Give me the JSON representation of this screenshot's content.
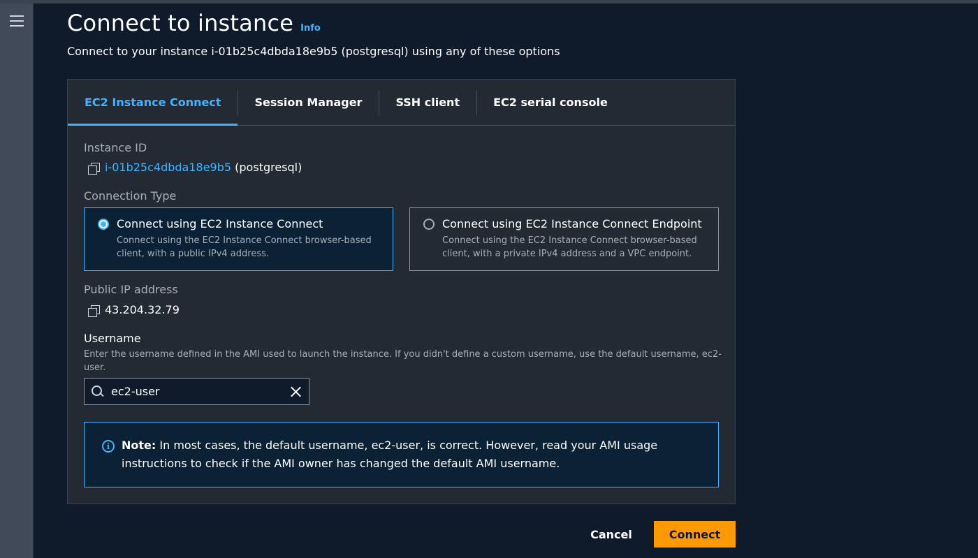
{
  "page": {
    "title": "Connect to instance",
    "info_label": "Info",
    "subtitle": "Connect to your instance i-01b25c4dbda18e9b5 (postgresql) using any of these options"
  },
  "tabs": [
    {
      "label": "EC2 Instance Connect",
      "active": true
    },
    {
      "label": "Session Manager",
      "active": false
    },
    {
      "label": "SSH client",
      "active": false
    },
    {
      "label": "EC2 serial console",
      "active": false
    }
  ],
  "instance": {
    "label": "Instance ID",
    "id": "i-01b25c4dbda18e9b5",
    "name": "(postgresql)"
  },
  "connection_type": {
    "label": "Connection Type",
    "options": [
      {
        "title": "Connect using EC2 Instance Connect",
        "description": "Connect using the EC2 Instance Connect browser-based client, with a public IPv4 address.",
        "selected": true
      },
      {
        "title": "Connect using EC2 Instance Connect Endpoint",
        "description": "Connect using the EC2 Instance Connect browser-based client, with a private IPv4 address and a VPC endpoint.",
        "selected": false
      }
    ]
  },
  "public_ip": {
    "label": "Public IP address",
    "value": "43.204.32.79"
  },
  "username": {
    "label": "Username",
    "help": "Enter the username defined in the AMI used to launch the instance. If you didn't define a custom username, use the default username, ec2-user.",
    "value": "ec2-user"
  },
  "note": {
    "prefix": "Note:",
    "text": " In most cases, the default username, ec2-user, is correct. However, read your AMI usage instructions to check if the AMI owner has changed the default AMI username."
  },
  "actions": {
    "cancel": "Cancel",
    "connect": "Connect"
  },
  "colors": {
    "accent": "#42b4ff",
    "primary_button": "#ff9900",
    "background": "#0f1b2a",
    "panel": "#232a33"
  },
  "icons": [
    "menu-icon",
    "copy-icon",
    "search-icon",
    "clear-icon",
    "info-circle-icon"
  ]
}
